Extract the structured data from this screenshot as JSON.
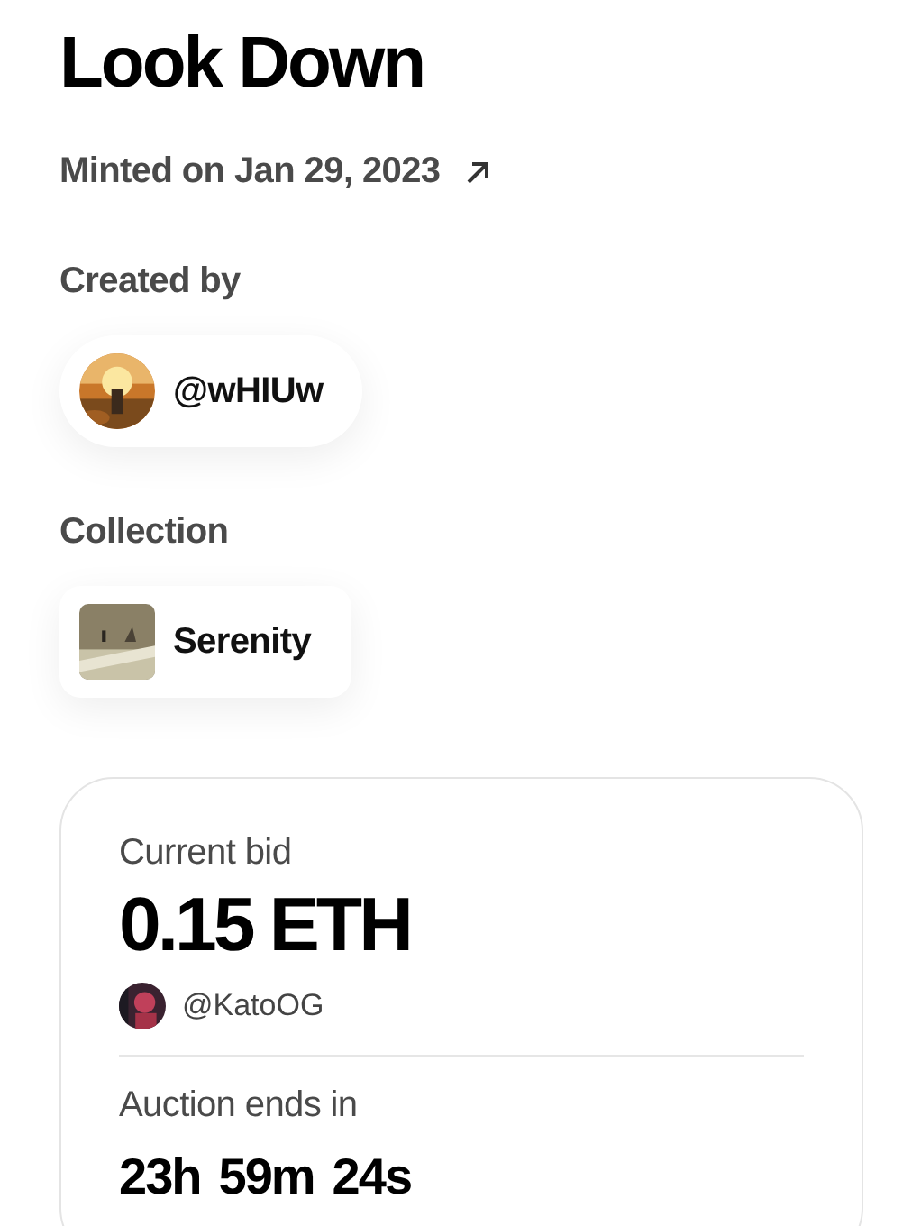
{
  "title": "Look Down",
  "minted": {
    "text": "Minted on Jan 29, 2023"
  },
  "creator": {
    "label": "Created by",
    "handle": "@wHIUw"
  },
  "collection": {
    "label": "Collection",
    "name": "Serenity"
  },
  "auction": {
    "bid_label": "Current bid",
    "bid_amount": "0.15 ETH",
    "bidder": "@KatoOG",
    "ends_label": "Auction ends in",
    "countdown": [
      "23h",
      "59m",
      "24s"
    ]
  }
}
